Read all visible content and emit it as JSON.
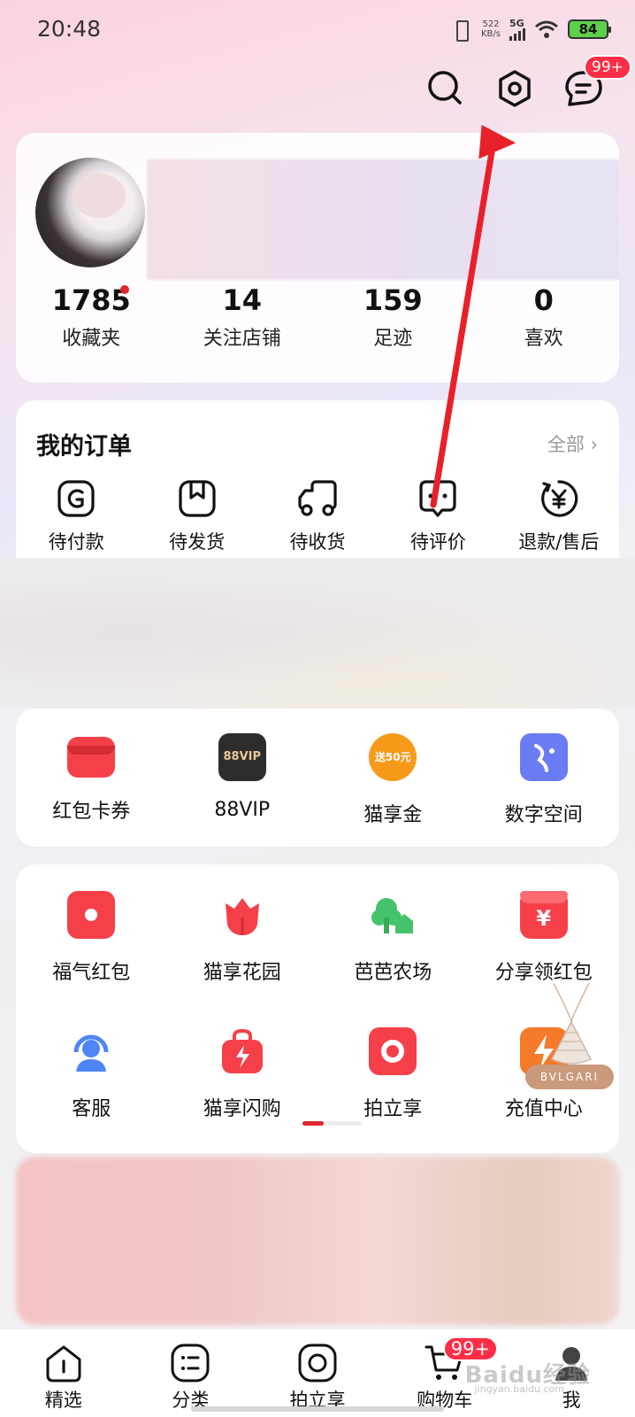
{
  "status": {
    "time": "20:48",
    "speed_value": "522",
    "speed_unit": "KB/s",
    "network": "5G",
    "battery": "84"
  },
  "header": {
    "message_badge": "99+"
  },
  "profile": {
    "stats": [
      {
        "value": "1785",
        "label": "收藏夹"
      },
      {
        "value": "14",
        "label": "关注店铺"
      },
      {
        "value": "159",
        "label": "足迹"
      },
      {
        "value": "0",
        "label": "喜欢"
      }
    ]
  },
  "orders": {
    "title": "我的订单",
    "all_label": "全部",
    "items": [
      {
        "label": "待付款",
        "icon": "wallet-icon"
      },
      {
        "label": "待发货",
        "icon": "box-icon"
      },
      {
        "label": "待收货",
        "icon": "truck-icon"
      },
      {
        "label": "待评价",
        "icon": "comment-icon"
      },
      {
        "label": "退款/售后",
        "icon": "refund-icon"
      }
    ]
  },
  "tools": [
    {
      "label": "红包卡券",
      "icon": "coupon-icon",
      "color": "#f5404a"
    },
    {
      "label": "88VIP",
      "icon": "vip-icon",
      "color": "#2d2d2d",
      "icon_text": "88VIP"
    },
    {
      "label": "猫享金",
      "icon": "coin-icon",
      "color": "#f79a1a",
      "icon_text": "送50元"
    },
    {
      "label": "数字空间",
      "icon": "digital-space-icon",
      "color": "#6a7cf3"
    }
  ],
  "apps": [
    {
      "label": "福气红包",
      "icon": "red-envelope-icon",
      "color": "#f5404a"
    },
    {
      "label": "猫享花园",
      "icon": "flower-icon",
      "color": "#f5404a"
    },
    {
      "label": "芭芭农场",
      "icon": "farm-icon",
      "color": "#45c36a"
    },
    {
      "label": "分享领红包",
      "icon": "share-envelope-icon",
      "color": "#f5404a"
    },
    {
      "label": "客服",
      "icon": "customer-service-icon",
      "color": "#4f86f5"
    },
    {
      "label": "猫享闪购",
      "icon": "flash-bag-icon",
      "color": "#f5404a"
    },
    {
      "label": "拍立享",
      "icon": "camera-icon",
      "color": "#f5404a"
    },
    {
      "label": "充值中心",
      "icon": "recharge-icon",
      "color": "#f57a2a"
    }
  ],
  "ad": {
    "brand": "BVLGARI"
  },
  "tabbar": [
    {
      "label": "精选",
      "icon": "home-icon"
    },
    {
      "label": "分类",
      "icon": "category-icon"
    },
    {
      "label": "拍立享",
      "icon": "camera-icon"
    },
    {
      "label": "购物车",
      "icon": "cart-icon",
      "badge": "99+"
    },
    {
      "label": "我",
      "icon": "me-icon"
    }
  ],
  "watermark": {
    "text": "Baidu经验",
    "sub": "jingyan.baidu.com"
  },
  "colors": {
    "accent": "#ff2d46",
    "arrow": "#e8202a"
  }
}
